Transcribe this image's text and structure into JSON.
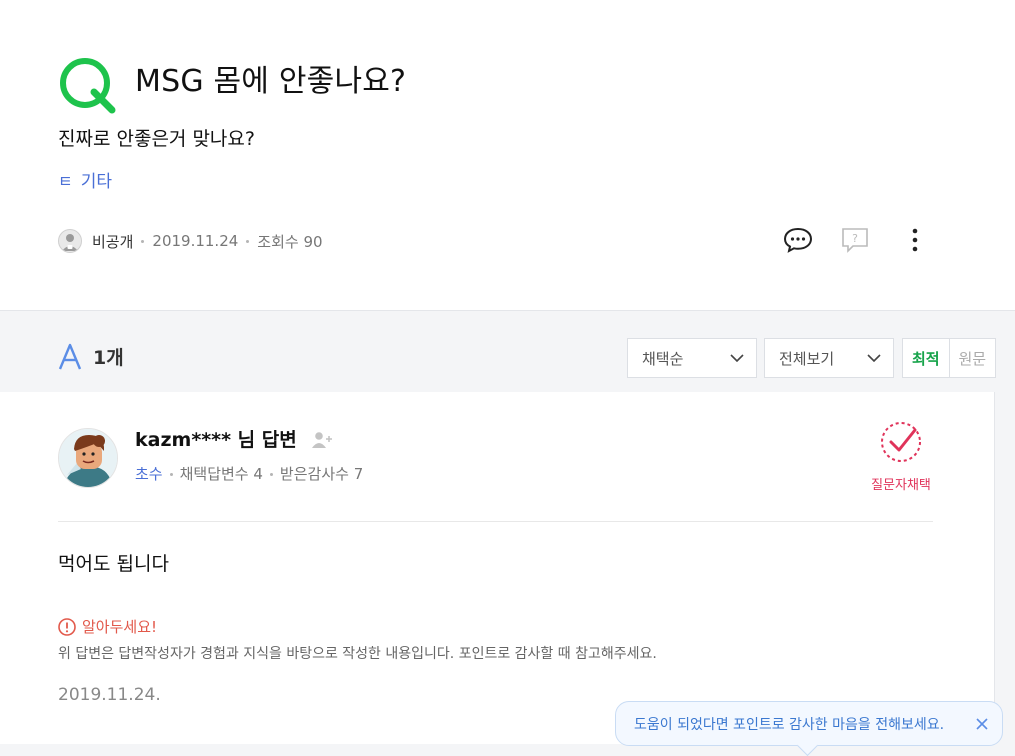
{
  "question": {
    "title": "MSG 몸에 안좋나요?",
    "body": "진짜로 안좋은거 맞나요?",
    "category_icon": "ㅌ",
    "category": "기타",
    "author": "비공개",
    "date": "2019.11.24",
    "views": "조회수 90"
  },
  "answers_header": {
    "count": "1개",
    "sort_select": "채택순",
    "filter_select": "전체보기",
    "toggle_on": "최적",
    "toggle_off": "원문"
  },
  "answer": {
    "name": "kazm**** 님 답변",
    "grade": "초수",
    "adopted": "채택답변수 4",
    "thanks": "받은감사수 7",
    "choose_label": "질문자채택",
    "body": "먹어도 됩니다",
    "notice_title": "알아두세요!",
    "notice_text": "위 답변은 답변작성자가 경험과 지식을 바탕으로 작성한 내용입니다. 포인트로 감사할 때 참고해주세요.",
    "date": "2019.11.24."
  },
  "tooltip": {
    "text": "도움이 되었다면 포인트로 감사한 마음을 전해보세요."
  },
  "colors": {
    "q_green": "#1ec34c",
    "a_blue": "#5b8de6",
    "link_blue": "#4a6fd6",
    "choose_red": "#e0335a",
    "notice_red": "#e2594b"
  }
}
